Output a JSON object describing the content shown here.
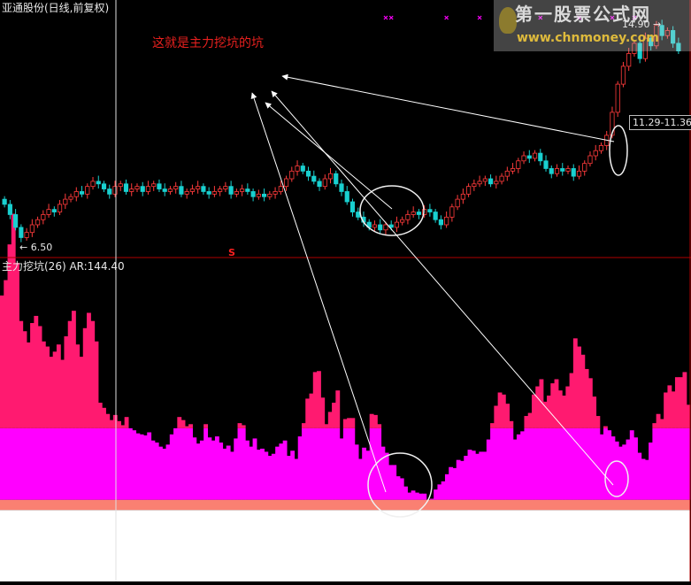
{
  "header": {
    "stock_title": "亚通股份(日线,前复权)",
    "indicator_title": "主力挖坑(26)  AR:144.40"
  },
  "annotation": {
    "text": "这就是主力挖坑的坑"
  },
  "price_labels": {
    "low": "← 6.50",
    "high": "14.90 →",
    "box": "11.29-11.36",
    "signal_marker": "S"
  },
  "watermark": {
    "line1": "第一股票公式网",
    "line2": "www.chnmoney.com"
  },
  "colors": {
    "background": "#000000",
    "candle_up": "#ff3b3b",
    "candle_down": "#19d0d0",
    "ar_top": "#ff1a70",
    "ar_mid": "#ff00ff",
    "band_salmon": "#fa8072",
    "band_white": "#ffffff",
    "separator": "#c00000",
    "arrow": "#ffffff",
    "cross_marker": "#ff00ff"
  },
  "chart_data": [
    {
      "type": "candlestick",
      "title": "亚通股份(日线,前复权)",
      "y_range": [
        6.2,
        15.2
      ],
      "labeled_low": 6.5,
      "labeled_high": 14.9,
      "series": [
        {
          "name": "close",
          "values": [
            7.9,
            7.5,
            7.0,
            6.6,
            6.8,
            7.1,
            7.3,
            7.5,
            7.7,
            7.6,
            7.9,
            8.1,
            8.2,
            8.4,
            8.3,
            8.6,
            8.8,
            8.7,
            8.5,
            8.3,
            8.6,
            8.7,
            8.4,
            8.5,
            8.6,
            8.4,
            8.6,
            8.7,
            8.5,
            8.4,
            8.5,
            8.6,
            8.3,
            8.4,
            8.5,
            8.6,
            8.4,
            8.3,
            8.4,
            8.5,
            8.6,
            8.3,
            8.4,
            8.5,
            8.4,
            8.2,
            8.3,
            8.2,
            8.3,
            8.4,
            8.6,
            8.9,
            9.2,
            9.4,
            9.2,
            9.0,
            8.8,
            8.6,
            8.9,
            9.1,
            8.7,
            8.4,
            8.0,
            7.6,
            7.4,
            7.2,
            7.0,
            7.1,
            6.9,
            7.1,
            7.0,
            7.2,
            7.3,
            7.5,
            7.6,
            7.5,
            7.7,
            7.6,
            7.3,
            7.1,
            7.4,
            7.8,
            8.1,
            8.3,
            8.6,
            8.7,
            8.8,
            8.9,
            8.7,
            8.8,
            9.0,
            9.2,
            9.3,
            9.6,
            9.8,
            9.7,
            9.9,
            9.6,
            9.3,
            9.1,
            9.3,
            9.2,
            9.3,
            9.0,
            9.2,
            9.5,
            9.8,
            10.0,
            10.2,
            10.6,
            11.5,
            12.6,
            13.3,
            13.8,
            14.2,
            13.6,
            14.4,
            14.1,
            14.9,
            14.5,
            14.7,
            14.2,
            13.9
          ]
        }
      ],
      "cross_markers_x_index": [
        69,
        70,
        80,
        86,
        97,
        104,
        110,
        114
      ]
    },
    {
      "type": "bar",
      "title": "主力挖坑(26)",
      "ar_value": 144.4,
      "thresholds": {
        "upper": 150,
        "salmon_top": 80,
        "white_top": 70
      },
      "y_range": [
        0,
        305
      ],
      "series": [
        {
          "name": "AR",
          "values": [
            200,
            215,
            250,
            280,
            232,
            175,
            165,
            154,
            173,
            180,
            170,
            155,
            150,
            140,
            145,
            152,
            137,
            160,
            175,
            185,
            152,
            140,
            168,
            183,
            175,
            155,
            95,
            90,
            84,
            78,
            83,
            77,
            73,
            81,
            70,
            68,
            65,
            64,
            63,
            66,
            58,
            56,
            52,
            50,
            54,
            64,
            70,
            81,
            78,
            72,
            74,
            61,
            55,
            58,
            74,
            61,
            58,
            62,
            56,
            50,
            53,
            47,
            60,
            75,
            73,
            58,
            52,
            60,
            49,
            50,
            47,
            43,
            45,
            52,
            55,
            58,
            43,
            48,
            40,
            62,
            75,
            99,
            104,
            125,
            126,
            100,
            74,
            86,
            95,
            107,
            60,
            79,
            80,
            80,
            54,
            40,
            51,
            48,
            84,
            83,
            74,
            52,
            46,
            34,
            34,
            23,
            21,
            13,
            7,
            9,
            7,
            6,
            6,
            0,
            1,
            10,
            15,
            18,
            25,
            32,
            31,
            39,
            38,
            43,
            49,
            48,
            45,
            47,
            47,
            59,
            75,
            92,
            105,
            103,
            94,
            77,
            59,
            64,
            67,
            82,
            85,
            103,
            111,
            118,
            96,
            102,
            114,
            118,
            107,
            102,
            111,
            124,
            158,
            150,
            142,
            128,
            119,
            101,
            82,
            64,
            72,
            68,
            62,
            57,
            52,
            54,
            59,
            68,
            61,
            46,
            40,
            39,
            56,
            75,
            84,
            79,
            105,
            112,
            106,
            120,
            120,
            125,
            93
          ]
        }
      ]
    }
  ]
}
